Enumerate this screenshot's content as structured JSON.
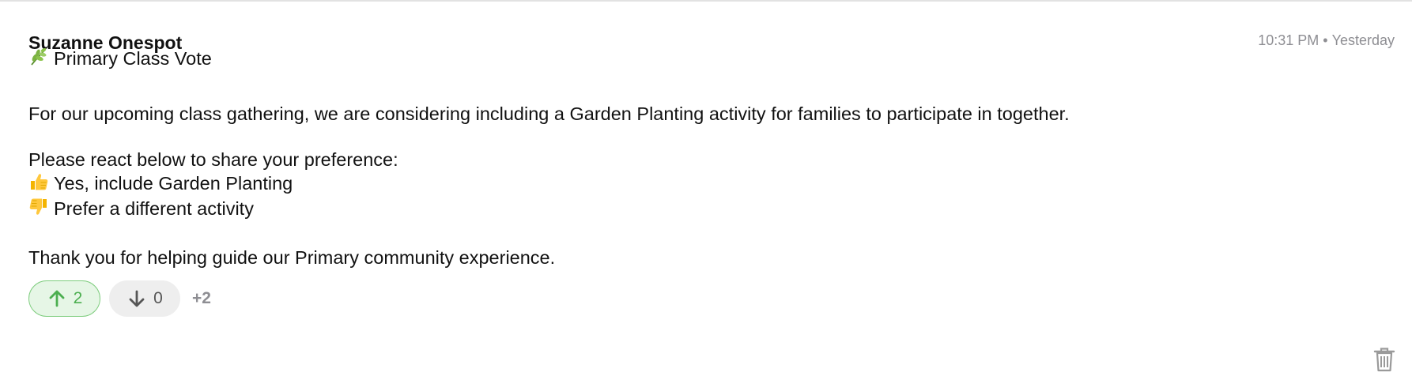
{
  "message": {
    "author": "Suzanne Onespot",
    "time": "10:31 PM",
    "day": "Yesterday",
    "separator": "•",
    "title": {
      "emoji_icon": "herb-icon",
      "text": "Primary Class Vote"
    },
    "body_paragraph_1": "For our upcoming class gathering, we are considering including a Garden Planting activity for families to participate in together.",
    "prompt": "Please react below to share your preference:",
    "options": [
      {
        "emoji_icon": "thumbs-up-icon",
        "text": "Yes, include Garden Planting"
      },
      {
        "emoji_icon": "thumbs-down-icon",
        "text": "Prefer a different activity"
      }
    ],
    "closing": "Thank you for helping guide our Primary community experience."
  },
  "reactions": {
    "upvote": {
      "icon": "arrow-up-icon",
      "count": "2",
      "color": "#4caf50"
    },
    "downvote": {
      "icon": "arrow-down-icon",
      "count": "0",
      "color": "#555555"
    },
    "more": "+2"
  },
  "actions": {
    "delete_icon": "trash-icon"
  },
  "colors": {
    "muted": "#8e8e93",
    "upvote_bg": "#e6f6e6",
    "upvote_border": "#7fcd7f",
    "downvote_bg": "#eeeeee"
  }
}
